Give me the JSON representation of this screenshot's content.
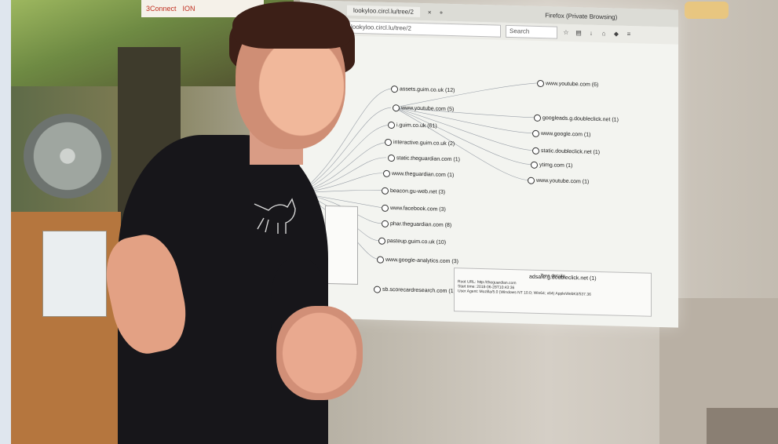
{
  "scene": {
    "description_labels": {
      "logos": [
        "3Connect",
        "ION"
      ]
    }
  },
  "browser": {
    "window_title": "Firefox (Private Browsing)",
    "url": "lookyloo.circl.lu/tree/2",
    "search_placeholder": "Search",
    "tab_plus": "+",
    "tab_close": "×"
  },
  "tree": {
    "left_nodes": [
      "assets.guim.co.uk (12)",
      "www.youtube.com (5)",
      "i.guim.co.uk (61)",
      "interactive.guim.co.uk (2)",
      "static.theguardian.com (1)",
      "www.theguardian.com (1)",
      "beacon.gu-web.net (3)",
      "www.facebook.com (3)",
      "phar.theguardian.com (8)",
      "pasteup.guim.co.uk (10)",
      "www.google-analytics.com (3)",
      "sb.scorecardresearch.com (1)"
    ],
    "right_nodes": [
      "www.youtube.com (6)",
      "googleads.g.doubleclick.net (1)",
      "www.google.com (1)",
      "static.doubleclick.net (1)",
      "ytimg.com (1)",
      "www.youtube.com (1)"
    ],
    "panel_title": "Tree details",
    "panel_lines": [
      "Root URL: http://theguardian.com",
      "Start time: 2018-06-28T10:43:36",
      "User Agent: Mozilla/5.0 (Windows NT 10.0; Win64; x64) AppleWebKit/537.36"
    ],
    "panel_node_label": "adsafe.g.doubleclick.net (1)"
  },
  "colors": {
    "screen_bg": "#f3f4f0",
    "shirt": "#17161a",
    "hair": "#3c1f17"
  }
}
